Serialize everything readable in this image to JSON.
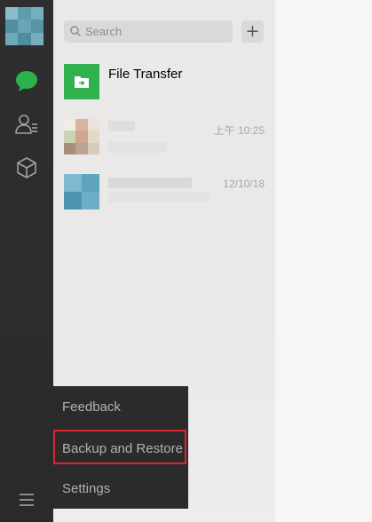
{
  "navbar": {
    "items": [
      {
        "name": "chat",
        "icon": "chat-bubble-icon",
        "active": true,
        "color": "#2bb24c"
      },
      {
        "name": "contacts",
        "icon": "contacts-icon",
        "active": false
      },
      {
        "name": "favorites",
        "icon": "cube-icon",
        "active": false
      },
      {
        "name": "menu",
        "icon": "hamburger-menu-icon",
        "active": false
      }
    ]
  },
  "search": {
    "placeholder": "Search",
    "add_label": "+"
  },
  "chats": [
    {
      "name": "File Transfer",
      "time": ""
    },
    {
      "name": "",
      "time": "上午 10:25"
    },
    {
      "name": "",
      "time": "12/10/18"
    }
  ],
  "menu": {
    "items": [
      {
        "label": "Feedback"
      },
      {
        "label": "Backup and Restore",
        "highlighted": true
      },
      {
        "label": "Settings"
      }
    ],
    "highlight_color": "#e0262d"
  },
  "colors": {
    "accent": "#2bb24c",
    "sidebar": "#2e2e2e",
    "menu_bg": "#2b2b2b"
  }
}
